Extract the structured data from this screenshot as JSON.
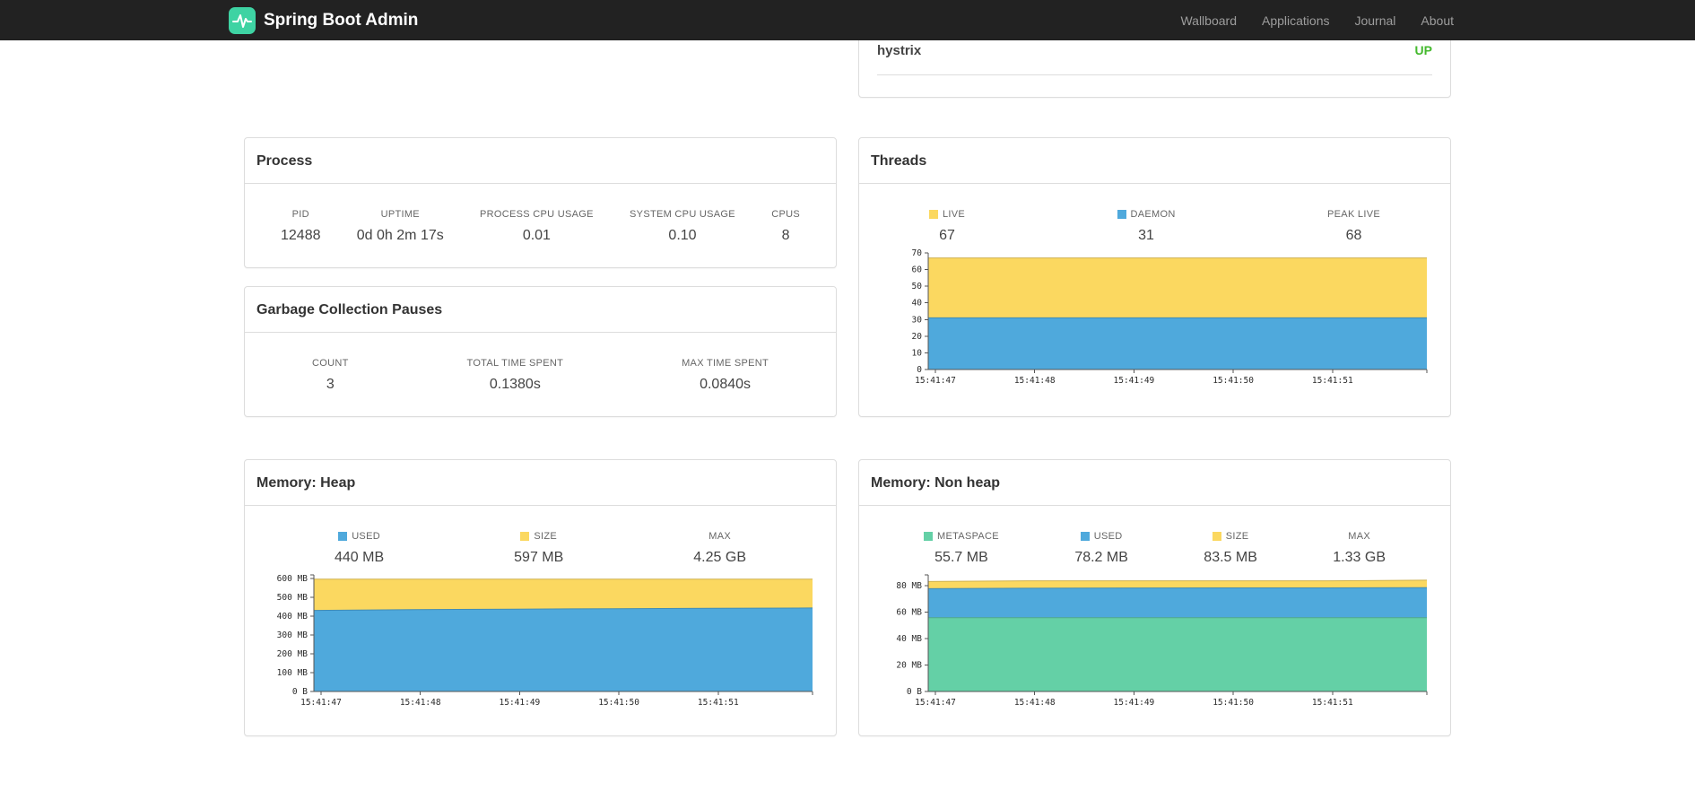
{
  "navbar": {
    "brand": "Spring Boot Admin",
    "items": [
      {
        "label": "Wallboard"
      },
      {
        "label": "Applications"
      },
      {
        "label": "Journal"
      },
      {
        "label": "About"
      }
    ]
  },
  "application": {
    "name": "hystrix",
    "status": "UP",
    "status_color": "#44b92e"
  },
  "process": {
    "title": "Process",
    "stats": [
      {
        "label": "PID",
        "value": "12488"
      },
      {
        "label": "UPTIME",
        "value": "0d 0h 2m 17s"
      },
      {
        "label": "PROCESS CPU USAGE",
        "value": "0.01"
      },
      {
        "label": "SYSTEM CPU USAGE",
        "value": "0.10"
      },
      {
        "label": "CPUS",
        "value": "8"
      }
    ]
  },
  "gc": {
    "title": "Garbage Collection Pauses",
    "stats": [
      {
        "label": "COUNT",
        "value": "3"
      },
      {
        "label": "TOTAL TIME SPENT",
        "value": "0.1380s"
      },
      {
        "label": "MAX TIME SPENT",
        "value": "0.0840s"
      }
    ]
  },
  "threads": {
    "title": "Threads",
    "legend": [
      {
        "label": "LIVE",
        "value": "67"
      },
      {
        "label": "DAEMON",
        "value": "31"
      },
      {
        "label": "PEAK LIVE",
        "value": "68"
      }
    ]
  },
  "heap": {
    "title": "Memory: Heap",
    "legend": [
      {
        "label": "USED",
        "value": "440 MB"
      },
      {
        "label": "SIZE",
        "value": "597 MB"
      },
      {
        "label": "MAX",
        "value": "4.25 GB"
      }
    ]
  },
  "nonheap": {
    "title": "Memory: Non heap",
    "legend": [
      {
        "label": "METASPACE",
        "value": "55.7 MB"
      },
      {
        "label": "USED",
        "value": "78.2 MB"
      },
      {
        "label": "SIZE",
        "value": "83.5 MB"
      },
      {
        "label": "MAX",
        "value": "1.33 GB"
      }
    ]
  },
  "chart_data": [
    {
      "type": "area",
      "title": "Threads",
      "x_labels": [
        "15:41:47",
        "15:41:48",
        "15:41:49",
        "15:41:50",
        "15:41:51"
      ],
      "ylim": [
        0,
        70
      ],
      "yticks": [
        0,
        10,
        20,
        30,
        40,
        50,
        60,
        70
      ],
      "ytick_labels": [
        "0",
        "10",
        "20",
        "30",
        "40",
        "50",
        "60",
        "70"
      ],
      "series": [
        {
          "name": "LIVE",
          "color": "#fbd860",
          "values": [
            67,
            67,
            67,
            67,
            67,
            67
          ]
        },
        {
          "name": "DAEMON",
          "color": "#4fa9dc",
          "values": [
            31,
            31,
            31,
            31,
            31,
            31
          ]
        }
      ]
    },
    {
      "type": "area",
      "title": "Memory: Heap",
      "x_labels": [
        "15:41:47",
        "15:41:48",
        "15:41:49",
        "15:41:50",
        "15:41:51"
      ],
      "ylim": [
        0,
        620
      ],
      "yticks": [
        0,
        100,
        200,
        300,
        400,
        500,
        600
      ],
      "ytick_labels": [
        "0 B",
        "100 MB",
        "200 MB",
        "300 MB",
        "400 MB",
        "500 MB",
        "600 MB"
      ],
      "series": [
        {
          "name": "SIZE",
          "color": "#fbd860",
          "values": [
            597,
            597,
            597,
            597,
            597,
            597
          ]
        },
        {
          "name": "USED",
          "color": "#4fa9dc",
          "values": [
            431,
            435,
            438,
            440,
            442,
            444
          ]
        }
      ]
    },
    {
      "type": "area",
      "title": "Memory: Non heap",
      "x_labels": [
        "15:41:47",
        "15:41:48",
        "15:41:49",
        "15:41:50",
        "15:41:51"
      ],
      "ylim": [
        0,
        88
      ],
      "yticks": [
        0,
        20,
        40,
        60,
        80
      ],
      "ytick_labels": [
        "0 B",
        "20 MB",
        "40 MB",
        "60 MB",
        "80 MB"
      ],
      "series": [
        {
          "name": "SIZE",
          "color": "#fbd860",
          "values": [
            83,
            83.5,
            83.5,
            83.5,
            83.5,
            84
          ]
        },
        {
          "name": "USED",
          "color": "#4fa9dc",
          "values": [
            77.6,
            77.9,
            78.1,
            78.2,
            78.2,
            78.3
          ]
        },
        {
          "name": "METASPACE",
          "color": "#64d0a6",
          "values": [
            55.7,
            55.7,
            55.7,
            55.7,
            55.7,
            55.7
          ]
        }
      ]
    }
  ]
}
